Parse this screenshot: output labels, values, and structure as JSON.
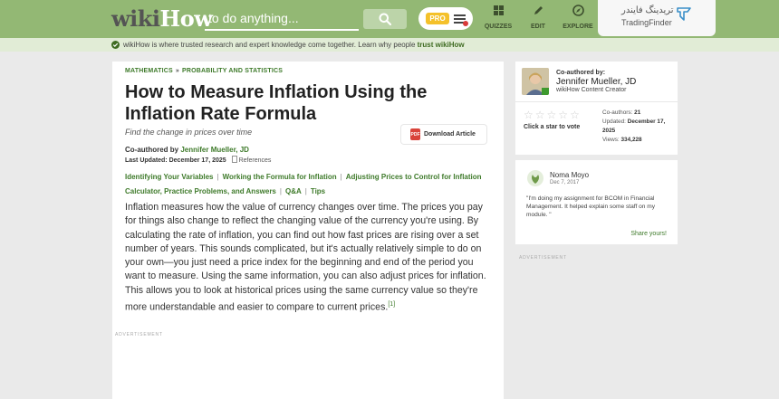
{
  "header": {
    "logo_wiki": "wiki",
    "logo_how": "How",
    "search_placeholder": "to do anything...",
    "pro_label": "PRO",
    "nav": [
      {
        "label": "QUIZZES",
        "icon": "quiz-icon"
      },
      {
        "label": "EDIT",
        "icon": "pencil-icon"
      },
      {
        "label": "EXPLORE",
        "icon": "compass-icon"
      }
    ],
    "tradingfinder_fa": "تریدینگ فایندر",
    "tradingfinder_en": "TradingFinder"
  },
  "banner": {
    "text": "wikiHow is where trusted research and expert knowledge come together. Learn why people",
    "link": "trust wikiHow"
  },
  "article": {
    "breadcrumb": [
      "MATHEMATICS",
      "PROBABILITY AND STATISTICS"
    ],
    "breadcrumb_sep": "»",
    "title": "How to Measure Inflation Using the Inflation Rate Formula",
    "subtitle": "Find the change in prices over time",
    "coauthored_prefix": "Co-authored by",
    "coauthor": "Jennifer Mueller, JD",
    "last_updated": "Last Updated: December 17, 2025",
    "references": "References",
    "download_label": "Download Article",
    "pdf_label": "PDF",
    "toc": [
      "Identifying Your Variables",
      "Working the Formula for Inflation",
      "Adjusting Prices to Control for Inflation",
      "Calculator, Practice Problems, and Answers",
      "Q&A",
      "Tips"
    ],
    "toc_sep": "|",
    "intro": "Inflation measures how the value of currency changes over time. The prices you pay for things also change to reflect the changing value of the currency you're using. By calculating the rate of inflation, you can find out how fast prices are rising over a set number of years. This sounds complicated, but it's actually relatively simple to do on your own—you just need a price index for the beginning and end of the period you want to measure. Using the same information, you can also adjust prices for inflation. This allows you to look at historical prices using the same currency value so they're more understandable and easier to compare to current prices.",
    "footnote": "[1]",
    "advertisement": "ADVERTISEMENT"
  },
  "sidebar": {
    "author_label": "Co-authored by:",
    "author_name": "Jennifer Mueller, JD",
    "author_role": "wikiHow Content Creator",
    "vote_label": "Click a star to vote",
    "rating_stars": 0,
    "coauthors_label": "Co-authors:",
    "coauthors_value": "21",
    "updated_label": "Updated:",
    "updated_value": "December 17, 2025",
    "views_label": "Views:",
    "views_value": "334,228",
    "review": {
      "name": "Noma Moyo",
      "date": "Dec 7, 2017",
      "text": "\"I'm doing my assignment for BCOM in Financial Management. It helped explain some staff on my module. \"",
      "share": "Share yours!"
    },
    "advertisement": "ADVERTISEMENT"
  },
  "colors": {
    "header": "#93b874",
    "accent_green": "#3e7a2a",
    "banner": "#e1ecd6",
    "pdf_red": "#d9433a"
  }
}
